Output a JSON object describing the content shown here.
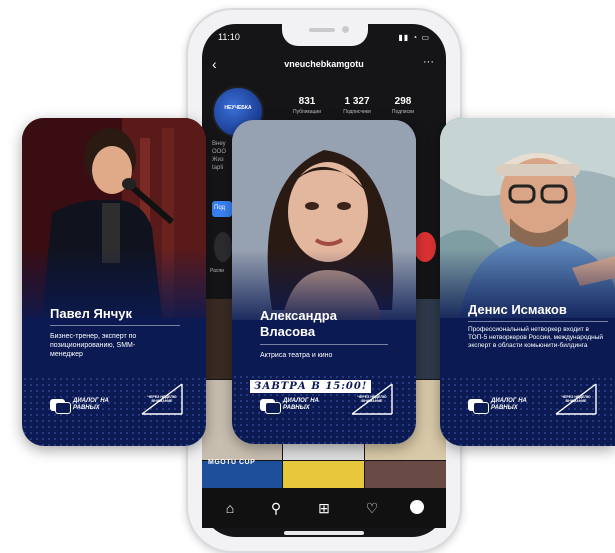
{
  "phone": {
    "status_time": "11:10",
    "profile_username": "vneuchebkamgotu",
    "avatar_text": "НЕУЧЕБКА",
    "stats": [
      {
        "value": "831",
        "label": "Публикации"
      },
      {
        "value": "1 327",
        "label": "Подписчики"
      },
      {
        "value": "298",
        "label": "Подписки"
      }
    ],
    "bio_lines": [
      "Внеу",
      "ООО",
      "Жиз",
      "tapli"
    ],
    "follow_button": "Под",
    "story_label": "Распи",
    "grid_label": "MGOTU CUP"
  },
  "cards": [
    {
      "name": "Павел Янчук",
      "description": "Бизнес-тренер, эксперт по позиционированию, SMM-менеджер",
      "logo_text": "ДИАЛОГ НА РАВНЫХ",
      "mark_text": "ЧЕРЕЗ НЕДЕЛЮ ВНИМАНИЕ"
    },
    {
      "name": "Александра Власова",
      "description": "Актриса театра и кино",
      "announcement": "ЗАВТРА В 15:00!",
      "logo_text": "ДИАЛОГ НА РАВНЫХ",
      "mark_text": "ЧЕРЕЗ НЕДЕЛЮ ВНИМАНИЕ"
    },
    {
      "name": "Денис Исмаков",
      "description": "Профессиональный нетворкер входит в ТОП-5 нетворкеров России, международный эксперт в области комьюнити-билдинга",
      "logo_text": "ДИАЛОГ НА РАВНЫХ",
      "mark_text": "ЧЕРЕЗ НЕДЕЛЮ ВНИМАНИЕ"
    }
  ],
  "colors": {
    "card_navy": "#0b1a52",
    "accent_blue": "#3b82f6",
    "phone_frame": "#f2f2f4"
  }
}
